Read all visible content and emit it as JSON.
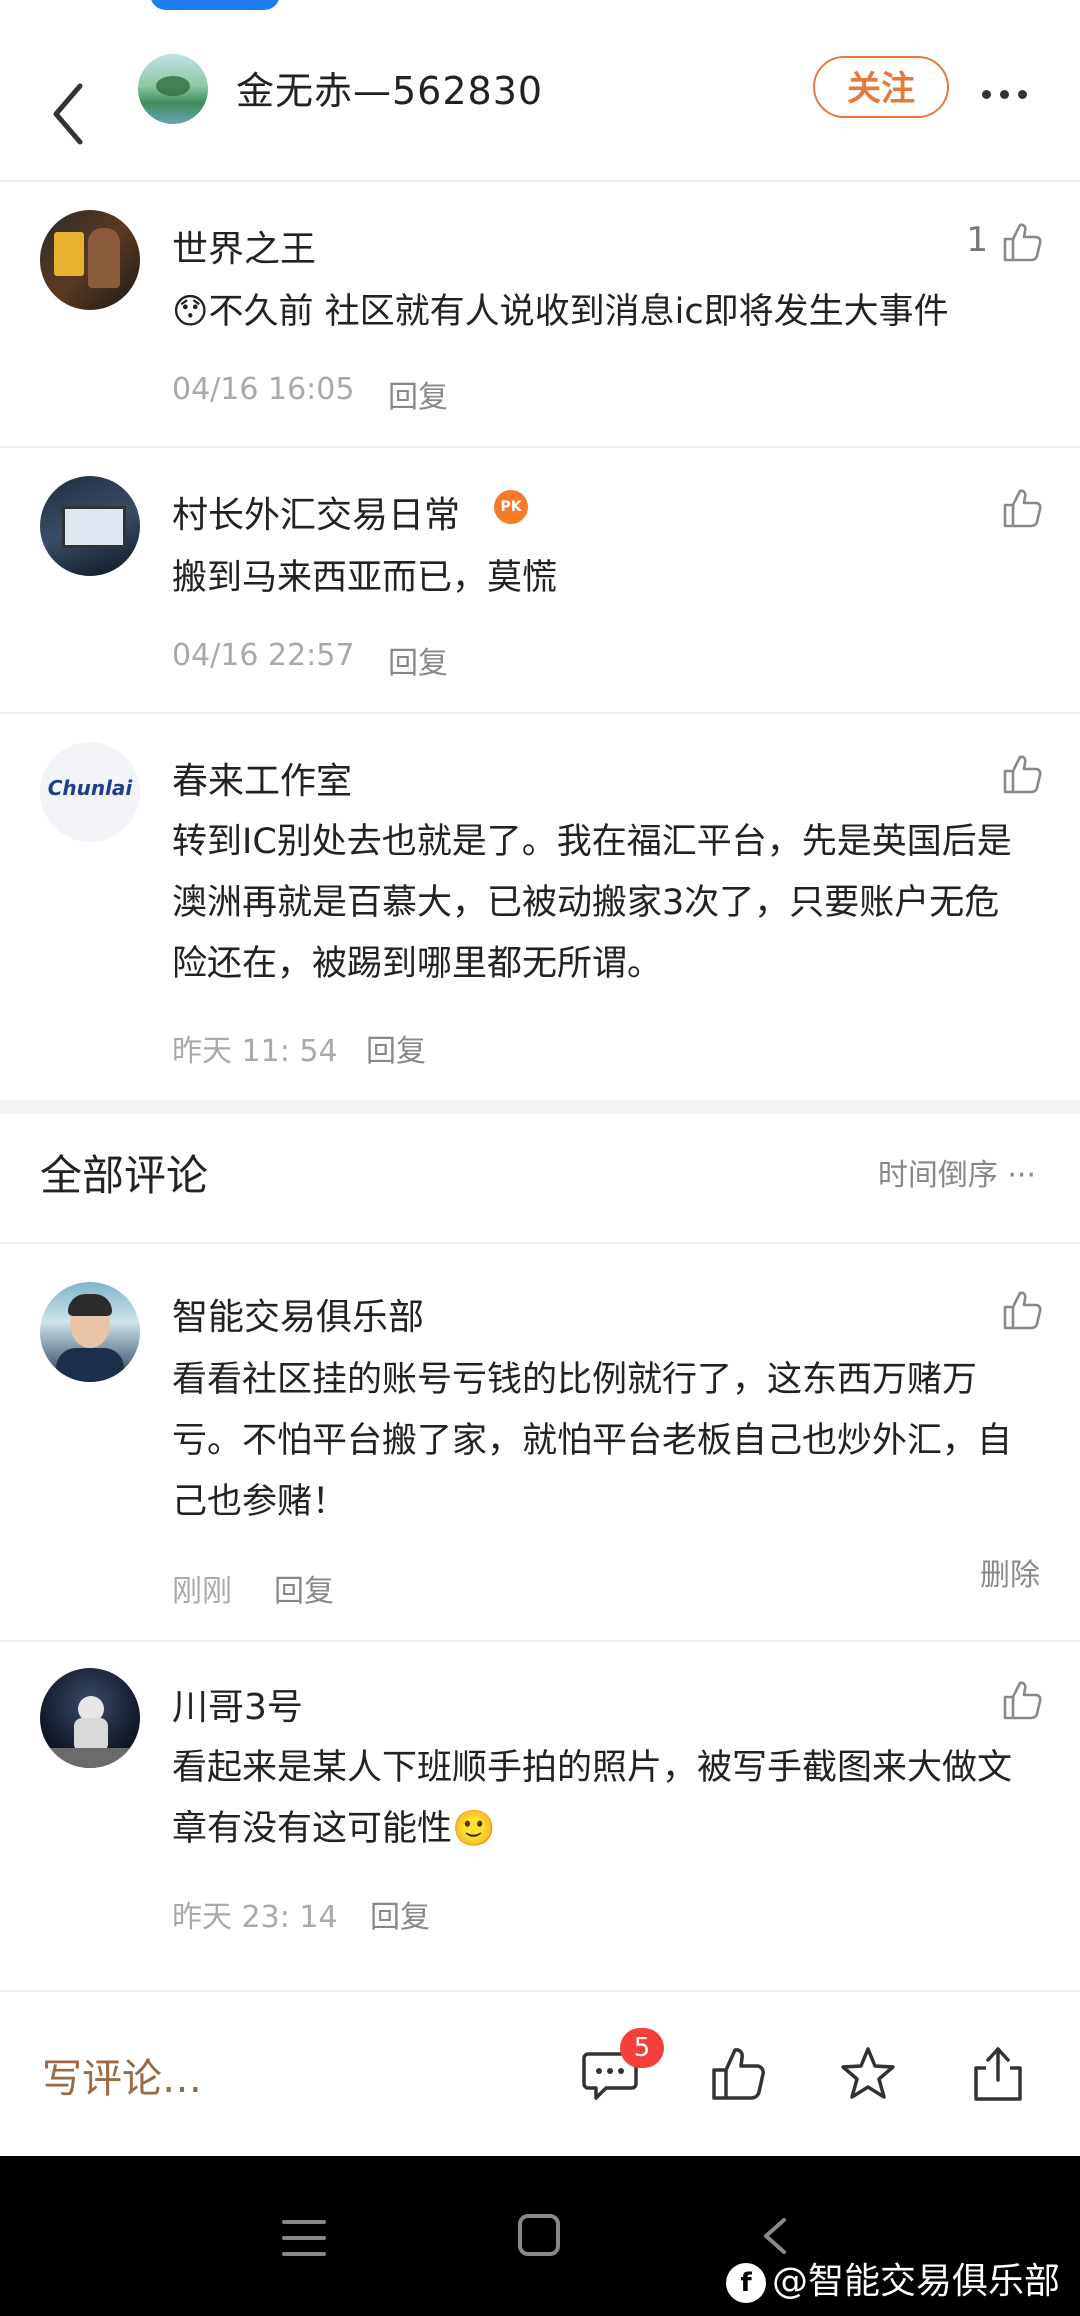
{
  "header": {
    "title": "金无赤—562830",
    "follow_label": "关注"
  },
  "top_comments": [
    {
      "name": "世界之王",
      "likes": "1",
      "text": "😯不久前 社区就有人说收到消息ic即将发生大事件",
      "time": "04/16 16:05",
      "reply": "回复"
    },
    {
      "name": "村长外汇交易日常",
      "likes": "",
      "text": "搬到马来西亚而已，莫慌",
      "time": "04/16 22:57",
      "reply": "回复"
    },
    {
      "name": "春来工作室",
      "likes": "",
      "text": "转到IC别处去也就是了。我在福汇平台，先是英国后是澳洲再就是百慕大，已被动搬家3次了，只要账户无危险还在，被踢到哪里都无所谓。",
      "time": "昨天 11: 54",
      "reply": "回复",
      "avatar_text": "Chunlai"
    }
  ],
  "all_comments": {
    "title": "全部评论",
    "sort_label": "时间倒序 ···",
    "items": [
      {
        "name": "智能交易俱乐部",
        "text": "看看社区挂的账号亏钱的比例就行了，这东西万赌万亏。不怕平台搬了家，就怕平台老板自己也炒外汇，自己也参赌！",
        "time": "刚刚",
        "reply": "回复",
        "delete": "删除"
      },
      {
        "name": "川哥3号",
        "text": "看起来是某人下班顺手拍的照片，被写手截图来大做文章有没有这可能性🙂",
        "time": "昨天 23: 14",
        "reply": "回复"
      }
    ]
  },
  "bottom_bar": {
    "write_placeholder": "写评论…",
    "comment_badge": "5",
    "icons": [
      "comment-icon",
      "thumbs-up-icon",
      "star-icon",
      "share-icon"
    ]
  },
  "navbar": {
    "watermark": "@智能交易俱乐部"
  },
  "colors": {
    "accent": "#e8773a",
    "badge": "#f4403b",
    "muted": "#a9a9a9"
  }
}
